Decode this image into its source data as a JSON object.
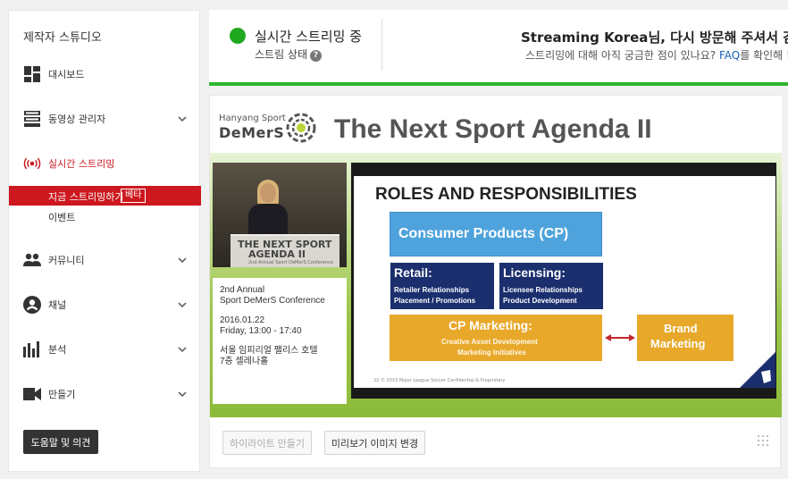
{
  "sidebar": {
    "title": "제작자 스튜디오",
    "items": [
      {
        "label": "대시보드",
        "icon": "dashboard-icon",
        "chevron": false
      },
      {
        "label": "동영상 관리자",
        "icon": "video-manager-icon",
        "chevron": true
      },
      {
        "label": "실시간 스트리밍",
        "icon": "live-icon",
        "chevron": false
      },
      {
        "label": "커뮤니티",
        "icon": "community-icon",
        "chevron": true
      },
      {
        "label": "채널",
        "icon": "channel-icon",
        "chevron": true
      },
      {
        "label": "분석",
        "icon": "analytics-icon",
        "chevron": true
      },
      {
        "label": "만들기",
        "icon": "create-icon",
        "chevron": true
      }
    ],
    "live_sub": [
      {
        "label": "지금 스트리밍하기",
        "badge": "베타",
        "active": true
      },
      {
        "label": "이벤트",
        "active": false
      }
    ],
    "help_button": "도움말 및 의견"
  },
  "status": {
    "title": "실시간 스트리밍 중",
    "subtitle": "스트림 상태",
    "status_color": "#20a820",
    "welcome_name": "Streaming Korea",
    "welcome_suffix": "님, 다시 방문해 주셔서 감사합",
    "welcome_sub_prefix": "스트리밍에 대해 아직 궁금한 점이 있나요? ",
    "welcome_sub_link": "FAQ",
    "welcome_sub_suffix": "를 확인해 !"
  },
  "preview": {
    "logo_line1": "Hanyang Sport",
    "logo_line2": "DeMerS",
    "banner_title": "The Next Sport Agenda II",
    "podium_line1": "THE NEXT SPORT",
    "podium_line2": "AGENDA II",
    "podium_line3": "2nd Annual Sport DeMerS Conference",
    "info": [
      "2nd Annual",
      "Sport DeMerS Conference",
      "2016.01.22",
      "Friday, 13:00 - 17:40",
      "서울 임피리얼 팰리스 호텔",
      "7층 셀레나홀"
    ],
    "slide": {
      "title": "ROLES AND RESPONSIBILITIES",
      "cp": "Consumer Products (CP)",
      "retail_head": "Retail:",
      "retail_lines": [
        "Retailer Relationships",
        "Placement / Promotions"
      ],
      "lic_head": "Licensing:",
      "lic_lines": [
        "Licensee Relationships",
        "Product Development"
      ],
      "cpm_head": "CP Marketing:",
      "cpm_lines": [
        "Creative Asset Development",
        "Marketing Initiatives"
      ],
      "brand_line1": "Brand",
      "brand_line2": "Marketing",
      "footer": "22   © 2015 Major League Soccer Confidential & Proprietary"
    }
  },
  "actions": {
    "highlight_button": "하이라이트 만들기",
    "thumbnail_button": "미리보기 이미지 변경"
  }
}
